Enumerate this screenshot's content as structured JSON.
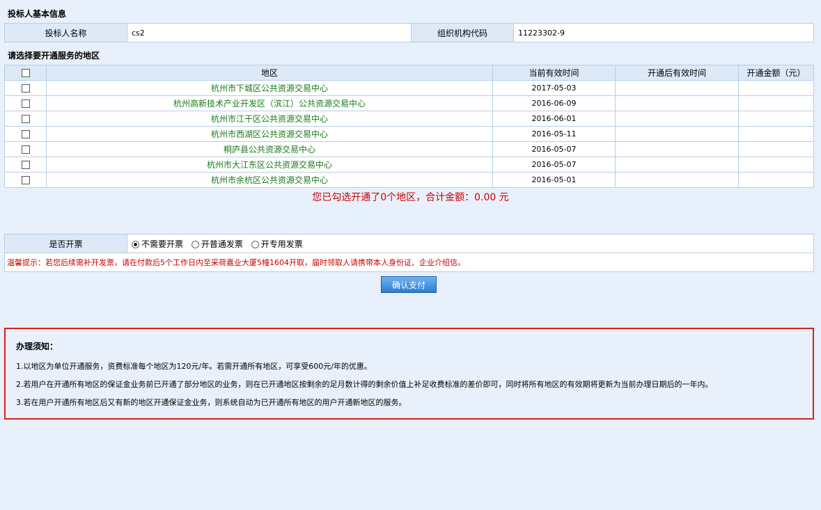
{
  "bidder_section": {
    "title": "投标人基本信息",
    "name_label": "投标人名称",
    "name_value": "cs2",
    "org_code_label": "组织机构代码",
    "org_code_value": "11223302-9"
  },
  "region_section": {
    "title": "请选择要开通服务的地区",
    "headers": {
      "region": "地区",
      "current_expiry": "当前有效时间",
      "new_expiry": "开通后有效时间",
      "amount": "开通金额（元）"
    },
    "rows": [
      {
        "name": "杭州市下城区公共资源交易中心",
        "date": "2017-05-03"
      },
      {
        "name": "杭州高新技术产业开发区（滨江）公共资源交易中心",
        "date": "2016-06-09"
      },
      {
        "name": "杭州市江干区公共资源交易中心",
        "date": "2016-06-01"
      },
      {
        "name": "杭州市西湖区公共资源交易中心",
        "date": "2016-05-11"
      },
      {
        "name": "桐庐县公共资源交易中心",
        "date": "2016-05-07"
      },
      {
        "name": "杭州市大江东区公共资源交易中心",
        "date": "2016-05-07"
      },
      {
        "name": "杭州市余杭区公共资源交易中心",
        "date": "2016-05-01"
      }
    ]
  },
  "summary": {
    "text": "您已勾选开通了0个地区，合计金额：0.00 元"
  },
  "invoice": {
    "label": "是否开票",
    "options": [
      "不需要开票",
      "开普通发票",
      "开专用发票"
    ],
    "selected": "不需要开票",
    "tip": "温馨提示：若您后续需补开发票，请在付款后5个工作日内至采荷嘉业大厦5幢1604开取，届时领取人请携带本人身份证、企业介绍信。"
  },
  "confirm_button": "确认支付",
  "notice": {
    "title": "办理须知：",
    "items": [
      "1.以地区为单位开通服务，资费标准每个地区为120元/年。若需开通所有地区，可享受600元/年的优惠。",
      "2.若用户在开通所有地区的保证金业务前已开通了部分地区的业务，则在已开通地区按剩余的足月数计得的剩余价值上补足收费标准的差价即可，同时将所有地区的有效期将更新为当前办理日期后的一年内。",
      "3.若在用户开通所有地区后又有新的地区开通保证金业务，则系统自动为已开通所有地区的用户开通新地区的服务。"
    ]
  },
  "colors": {
    "page_bg": "#e8f0fb",
    "label_bg": "#dde9f7",
    "region_name": "#1a7a1a",
    "warning": "#cc0000",
    "notice_border": "#d7211c"
  }
}
